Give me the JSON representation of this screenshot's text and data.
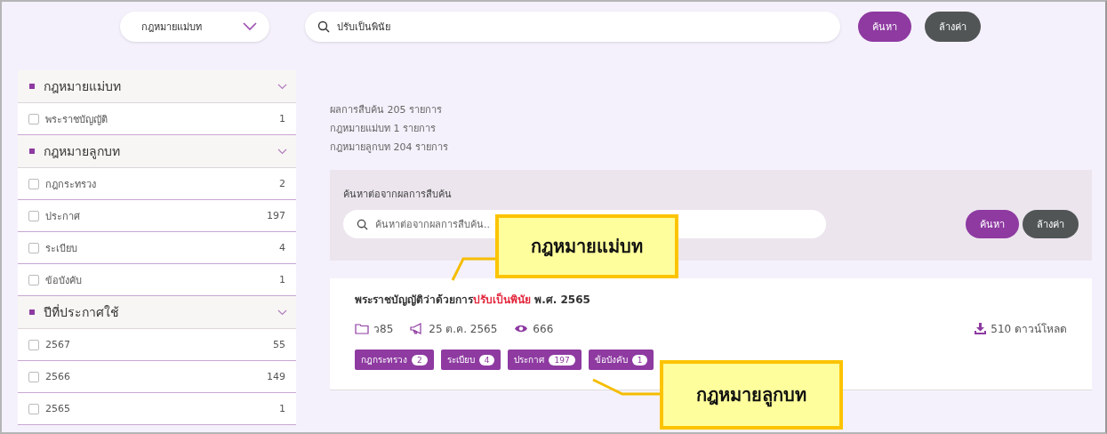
{
  "top_bar": {
    "category_select": {
      "value": "กฎหมายแม่บท"
    },
    "search": {
      "value": "ปรับเป็นพินัย"
    },
    "buttons": [
      {
        "label": "ค้นหา",
        "kind": "primary"
      },
      {
        "label": "ล้างค่า",
        "kind": "secondary"
      }
    ]
  },
  "sidebar": {
    "groups": [
      {
        "title": "กฎหมายแม่บท",
        "expanded": true,
        "items": [
          {
            "label": "พระราชบัญญัติ",
            "count": "1",
            "checked": false
          }
        ]
      },
      {
        "title": "กฎหมายลูกบท",
        "expanded": true,
        "items": [
          {
            "label": "กฎกระทรวง",
            "count": "2",
            "checked": false
          },
          {
            "label": "ประกาศ",
            "count": "197",
            "checked": false
          },
          {
            "label": "ระเบียบ",
            "count": "4",
            "checked": false
          },
          {
            "label": "ข้อบังคับ",
            "count": "1",
            "checked": false
          }
        ]
      },
      {
        "title": "ปีที่ประกาศใช้",
        "expanded": true,
        "items": [
          {
            "label": "2567",
            "count": "55",
            "checked": false
          },
          {
            "label": "2566",
            "count": "149",
            "checked": false
          },
          {
            "label": "2565",
            "count": "1",
            "checked": false
          }
        ]
      }
    ]
  },
  "summary": [
    "ผลการสืบค้น 205 รายการ",
    "กฎหมายแม่บท 1 รายการ",
    "กฎหมายลูกบท 204 รายการ"
  ],
  "refine": {
    "label": "ค้นหาต่อจากผลการสืบค้น",
    "placeholder": "ค้นหาต่อจากผลการสืบค้น..",
    "buttons": [
      {
        "label": "ค้นหา",
        "kind": "primary"
      },
      {
        "label": "ล้างค่า",
        "kind": "secondary"
      }
    ]
  },
  "results": [
    {
      "title": [
        {
          "text": "พระราชบัญญัติว่าด้วยการ",
          "highlight": false
        },
        {
          "text": "ปรับเป็นพินัย",
          "highlight": true
        },
        {
          "text": " พ.ศ. 2565",
          "highlight": false
        }
      ],
      "folder": "ว85",
      "date": "25 ต.ค. 2565",
      "views": "666",
      "downloads": "510 ดาวน์โหลด",
      "tags": [
        {
          "label": "กฎกระทรวง",
          "count": "2"
        },
        {
          "label": "ระเบียบ",
          "count": "4"
        },
        {
          "label": "ประกาศ",
          "count": "197"
        },
        {
          "label": "ข้อบังคับ",
          "count": "1"
        }
      ]
    }
  ],
  "callouts": [
    {
      "text": "กฎหมายแม่บท",
      "kind": "upper"
    },
    {
      "text": "กฎหมายลูกบท",
      "kind": "lower"
    }
  ]
}
